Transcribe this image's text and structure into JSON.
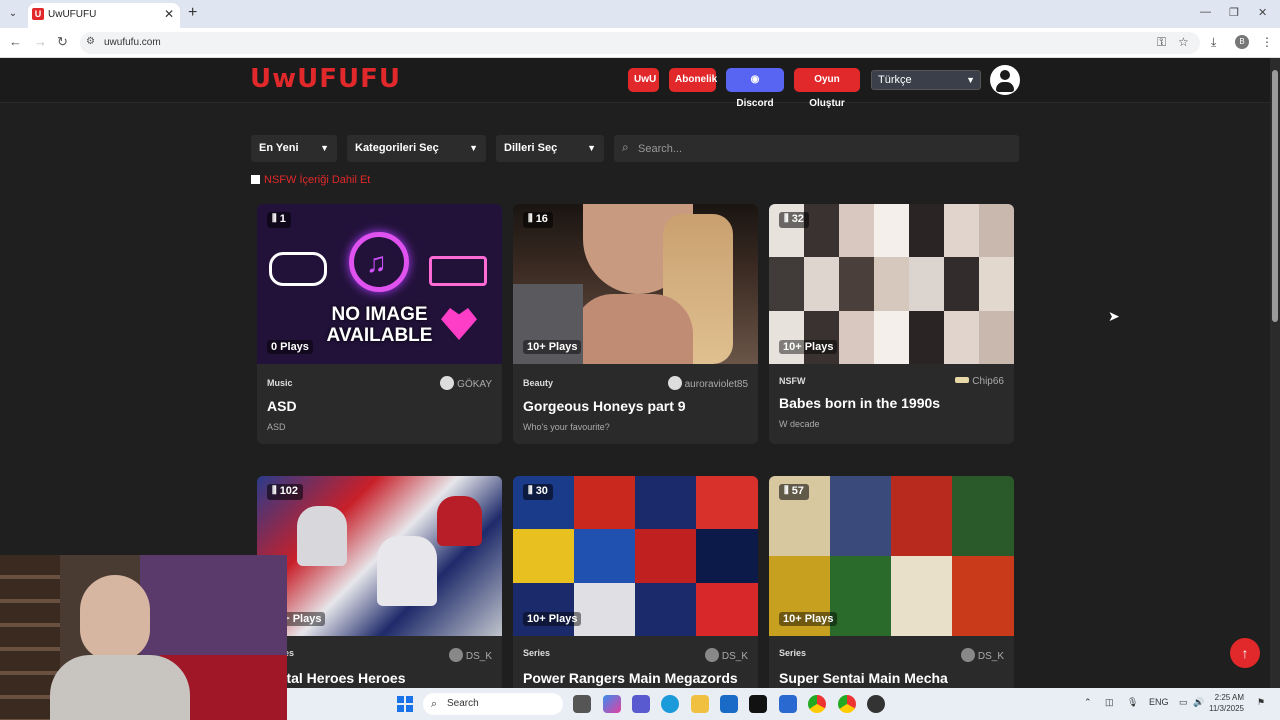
{
  "browser": {
    "tab_title": "UwUFUFU",
    "url": "uwufufu.com",
    "profile_initial": "B"
  },
  "header": {
    "logo": "UwUFUFU",
    "buttons": [
      "UwU",
      "Abonelik",
      "Discord",
      "Oyun Oluştur"
    ],
    "language": "Türkçe"
  },
  "filters": {
    "sort": "En Yeni",
    "category": "Kategorileri Seç",
    "language": "Dilleri Seç",
    "search_placeholder": "Search...",
    "nsfw_label": "NSFW İçeriği Dahil Et"
  },
  "cards": [
    {
      "count": "1",
      "plays": "0 Plays",
      "category": "Music",
      "author": "GÖKAY",
      "title": "ASD",
      "desc": "ASD",
      "thumb": "no-image"
    },
    {
      "count": "16",
      "plays": "10+ Plays",
      "category": "Beauty",
      "author": "auroraviolet85",
      "title": "Gorgeous Honeys part 9",
      "desc": "Who's your favourite?",
      "thumb": "portrait"
    },
    {
      "count": "32",
      "plays": "10+ Plays",
      "category": "NSFW",
      "author": "Chip66",
      "title": "Babes born in the 1990s",
      "desc": "W decade",
      "thumb": "collage-light"
    },
    {
      "count": "102",
      "plays": "10+ Plays",
      "category": "Series",
      "author": "DS_K",
      "title": "Metal Heroes Heroes",
      "desc": "",
      "thumb": "heroes"
    },
    {
      "count": "30",
      "plays": "10+ Plays",
      "category": "Series",
      "author": "DS_K",
      "title": "Power Rangers Main Megazords",
      "desc": "",
      "thumb": "robots"
    },
    {
      "count": "57",
      "plays": "10+ Plays",
      "category": "Series",
      "author": "DS_K",
      "title": "Super Sentai Main Mecha",
      "desc": "",
      "thumb": "mecha"
    }
  ],
  "no_image_text": [
    "NO IMAGE",
    "AVAILABLE"
  ],
  "taskbar": {
    "search": "Search",
    "lang": "ENG",
    "time": "2:25 AM",
    "date": "11/3/2025"
  }
}
